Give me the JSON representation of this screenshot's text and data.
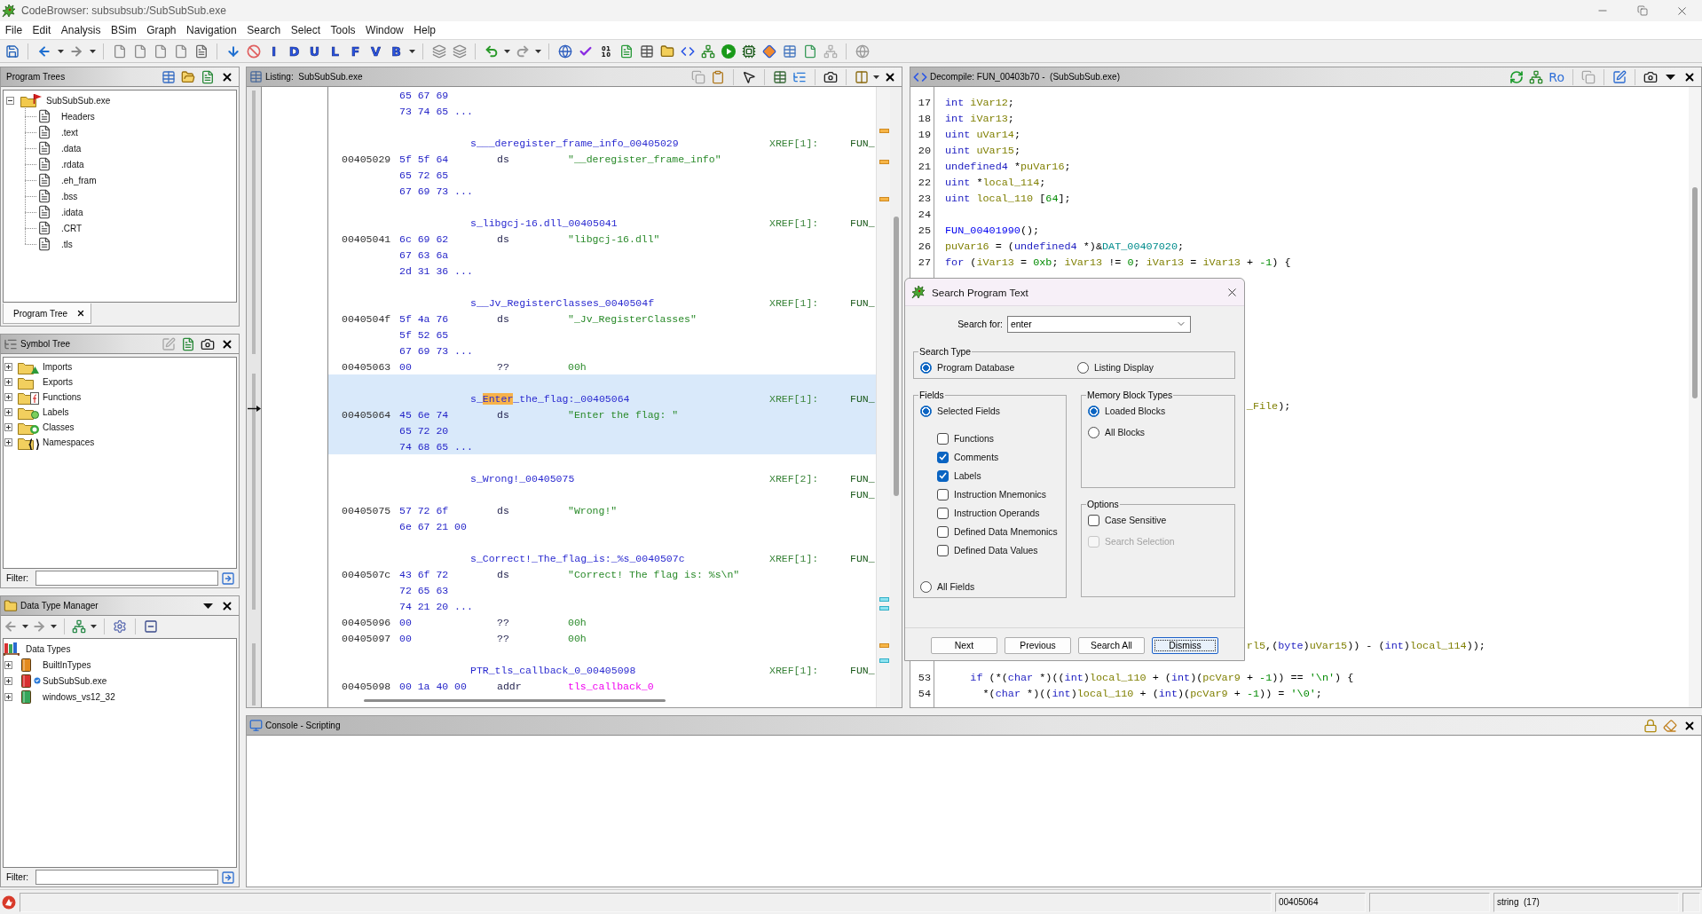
{
  "window": {
    "title": "CodeBrowser: subsubsub:/SubSubSub.exe"
  },
  "menu": [
    "File",
    "Edit",
    "Analysis",
    "BSim",
    "Graph",
    "Navigation",
    "Search",
    "Select",
    "Tools",
    "Window",
    "Help"
  ],
  "toolbar": {
    "letter_buttons": [
      "I",
      "D",
      "U",
      "L",
      "F",
      "V",
      "B"
    ]
  },
  "program_trees": {
    "title": "Program Trees",
    "root": {
      "label": "SubSubSub.exe",
      "expanded": true,
      "children": [
        {
          "label": "Headers"
        },
        {
          "label": ".text"
        },
        {
          "label": ".data"
        },
        {
          "label": ".rdata"
        },
        {
          "label": ".eh_fram"
        },
        {
          "label": ".bss"
        },
        {
          "label": ".idata"
        },
        {
          "label": ".CRT"
        },
        {
          "label": ".tls"
        }
      ]
    },
    "tab": {
      "label": "Program Tree",
      "selected": true
    }
  },
  "symbol_tree": {
    "title": "Symbol Tree",
    "items": [
      {
        "label": "Imports",
        "kind": "imports",
        "expanded": false
      },
      {
        "label": "Exports",
        "kind": "exports",
        "expanded": false
      },
      {
        "label": "Functions",
        "kind": "functions",
        "expanded": false
      },
      {
        "label": "Labels",
        "kind": "labels",
        "expanded": false
      },
      {
        "label": "Classes",
        "kind": "classes",
        "expanded": false
      },
      {
        "label": "Namespaces",
        "kind": "namespaces",
        "expanded": false
      }
    ],
    "filter_label": "Filter:"
  },
  "data_type_manager": {
    "title": "Data Type Manager",
    "root": {
      "label": "Data Types",
      "children": [
        {
          "label": "BuiltInTypes",
          "kind": "builtin",
          "expanded": false
        },
        {
          "label": "SubSubSub.exe",
          "kind": "program",
          "expanded": false
        },
        {
          "label": "windows_vs12_32",
          "kind": "archive",
          "expanded": false
        }
      ]
    },
    "filter_label": "Filter:"
  },
  "listing": {
    "title": "Listing:  SubSubSub.exe",
    "rows": [
      {
        "kind": "data",
        "selected": false,
        "bytes": "65 67 69"
      },
      {
        "kind": "data",
        "selected": false,
        "bytes": "73 74 65 ..."
      },
      {
        "kind": "blank",
        "selected": false
      },
      {
        "kind": "label",
        "selected": false,
        "label": [
          {
            "text": "s___deregister_frame_info_00405029",
            "match": false
          }
        ],
        "xref": "XREF[1]:",
        "xref_from": "FUN_"
      },
      {
        "kind": "data",
        "selected": false,
        "address": "00405029",
        "bytes": "5f 5f 64",
        "mnemonic": "ds",
        "operand": {
          "text": "\"__deregister_frame_info\"",
          "kind": "string"
        }
      },
      {
        "kind": "data",
        "selected": false,
        "bytes": "65 72 65"
      },
      {
        "kind": "data",
        "selected": false,
        "bytes": "67 69 73 ..."
      },
      {
        "kind": "blank",
        "selected": false
      },
      {
        "kind": "label",
        "selected": false,
        "label": [
          {
            "text": "s_libgcj-16.dll_00405041",
            "match": false
          }
        ],
        "xref": "XREF[1]:",
        "xref_from": "FUN_"
      },
      {
        "kind": "data",
        "selected": false,
        "address": "00405041",
        "bytes": "6c 69 62",
        "mnemonic": "ds",
        "operand": {
          "text": "\"libgcj-16.dll\"",
          "kind": "string"
        }
      },
      {
        "kind": "data",
        "selected": false,
        "bytes": "67 63 6a"
      },
      {
        "kind": "data",
        "selected": false,
        "bytes": "2d 31 36 ..."
      },
      {
        "kind": "blank",
        "selected": false
      },
      {
        "kind": "label",
        "selected": false,
        "label": [
          {
            "text": "s__Jv_RegisterClasses_0040504f",
            "match": false
          }
        ],
        "xref": "XREF[1]:",
        "xref_from": "FUN_"
      },
      {
        "kind": "data",
        "selected": false,
        "address": "0040504f",
        "bytes": "5f 4a 76",
        "mnemonic": "ds",
        "operand": {
          "text": "\"_Jv_RegisterClasses\"",
          "kind": "string"
        }
      },
      {
        "kind": "data",
        "selected": false,
        "bytes": "5f 52 65"
      },
      {
        "kind": "data",
        "selected": false,
        "bytes": "67 69 73 ..."
      },
      {
        "kind": "data",
        "selected": false,
        "address": "00405063",
        "bytes": "00",
        "mnemonic": "??",
        "operand": {
          "text": "00h",
          "kind": "scalar"
        }
      },
      {
        "kind": "blank",
        "selected": true
      },
      {
        "kind": "label",
        "selected": true,
        "label": [
          {
            "text": "s_",
            "match": false
          },
          {
            "text": "Enter",
            "match": true
          },
          {
            "text": "_the_flag:_00405064",
            "match": false
          }
        ],
        "xref": "XREF[1]:",
        "xref_from": "FUN_"
      },
      {
        "kind": "data",
        "selected": true,
        "address": "00405064",
        "bytes": "45 6e 74",
        "mnemonic": "ds",
        "operand": {
          "text": "\"Enter the flag: \"",
          "kind": "string"
        }
      },
      {
        "kind": "data",
        "selected": true,
        "bytes": "65 72 20"
      },
      {
        "kind": "data",
        "selected": true,
        "bytes": "74 68 65 ..."
      },
      {
        "kind": "blank",
        "selected": false
      },
      {
        "kind": "label",
        "selected": false,
        "label": [
          {
            "text": "s_Wrong!_00405075",
            "match": false
          }
        ],
        "xref": "XREF[2]:",
        "xref_from": "FUN_"
      },
      {
        "kind": "xref",
        "selected": false,
        "xref_from": "FUN_"
      },
      {
        "kind": "data",
        "selected": false,
        "address": "00405075",
        "bytes": "57 72 6f",
        "mnemonic": "ds",
        "operand": {
          "text": "\"Wrong!\"",
          "kind": "string"
        }
      },
      {
        "kind": "data",
        "selected": false,
        "bytes": "6e 67 21 00"
      },
      {
        "kind": "blank",
        "selected": false
      },
      {
        "kind": "label",
        "selected": false,
        "label": [
          {
            "text": "s_Correct!_The_flag_is:_%s_0040507c",
            "match": false
          }
        ],
        "xref": "XREF[1]:",
        "xref_from": "FUN_"
      },
      {
        "kind": "data",
        "selected": false,
        "address": "0040507c",
        "bytes": "43 6f 72",
        "mnemonic": "ds",
        "operand": {
          "text": "\"Correct! The flag is: %s\\n\"",
          "kind": "string"
        }
      },
      {
        "kind": "data",
        "selected": false,
        "bytes": "72 65 63"
      },
      {
        "kind": "data",
        "selected": false,
        "bytes": "74 21 20 ..."
      },
      {
        "kind": "data",
        "selected": false,
        "address": "00405096",
        "bytes": "00",
        "mnemonic": "??",
        "operand": {
          "text": "00h",
          "kind": "scalar"
        }
      },
      {
        "kind": "data",
        "selected": false,
        "address": "00405097",
        "bytes": "00",
        "mnemonic": "??",
        "operand": {
          "text": "00h",
          "kind": "scalar"
        }
      },
      {
        "kind": "blank",
        "selected": false
      },
      {
        "kind": "label",
        "selected": false,
        "label": [
          {
            "text": "PTR_tls_callback_0_00405098",
            "match": false
          }
        ],
        "xref": "XREF[1]:",
        "xref_from": "FUN_"
      },
      {
        "kind": "data",
        "selected": false,
        "address": "00405098",
        "bytes": "00 1a 40 00",
        "mnemonic": "addr",
        "operand": {
          "text": "tls_callback_0",
          "kind": "pointer"
        }
      }
    ]
  },
  "decompiler": {
    "title": "Decompile: FUN_00403b70 -  (SubSubSub.exe)",
    "toggle_label": "Ro",
    "top_lines": [
      {
        "number": "17",
        "tokens": [
          {
            "text": "int",
            "kind": "type"
          },
          {
            "text": " iVar12",
            "kind": "var"
          },
          {
            "text": ";",
            "kind": "plain"
          }
        ]
      },
      {
        "number": "18",
        "tokens": [
          {
            "text": "int",
            "kind": "type"
          },
          {
            "text": " iVar13",
            "kind": "var"
          },
          {
            "text": ";",
            "kind": "plain"
          }
        ]
      },
      {
        "number": "19",
        "tokens": [
          {
            "text": "uint",
            "kind": "type"
          },
          {
            "text": " uVar14",
            "kind": "var"
          },
          {
            "text": ";",
            "kind": "plain"
          }
        ]
      },
      {
        "number": "20",
        "tokens": [
          {
            "text": "uint",
            "kind": "type"
          },
          {
            "text": " uVar15",
            "kind": "var"
          },
          {
            "text": ";",
            "kind": "plain"
          }
        ]
      },
      {
        "number": "21",
        "tokens": [
          {
            "text": "undefined4",
            "kind": "type"
          },
          {
            "text": " *",
            "kind": "plain"
          },
          {
            "text": "puVar16",
            "kind": "var"
          },
          {
            "text": ";",
            "kind": "plain"
          }
        ]
      },
      {
        "number": "22",
        "tokens": [
          {
            "text": "uint",
            "kind": "type"
          },
          {
            "text": " *",
            "kind": "plain"
          },
          {
            "text": "local_114",
            "kind": "var"
          },
          {
            "text": ";",
            "kind": "plain"
          }
        ]
      },
      {
        "number": "23",
        "tokens": [
          {
            "text": "uint",
            "kind": "type"
          },
          {
            "text": " local_110",
            "kind": "var"
          },
          {
            "text": " [",
            "kind": "plain"
          },
          {
            "text": "64",
            "kind": "const"
          },
          {
            "text": "];",
            "kind": "plain"
          }
        ]
      },
      {
        "number": "24"
      },
      {
        "number": "25",
        "tokens": [
          {
            "text": "FUN_00401990",
            "kind": "func"
          },
          {
            "text": "();",
            "kind": "plain"
          }
        ]
      },
      {
        "number": "26",
        "tokens": [
          {
            "text": "puVar16",
            "kind": "var"
          },
          {
            "text": " = (",
            "kind": "plain"
          },
          {
            "text": "undefined4",
            "kind": "type"
          },
          {
            "text": " *)&",
            "kind": "plain"
          },
          {
            "text": "DAT_00407020",
            "kind": "global"
          },
          {
            "text": ";",
            "kind": "plain"
          }
        ]
      },
      {
        "number": "27",
        "tokens": [
          {
            "text": "for",
            "kind": "keyword"
          },
          {
            "text": " (",
            "kind": "plain"
          },
          {
            "text": "iVar13",
            "kind": "var"
          },
          {
            "text": " = ",
            "kind": "plain"
          },
          {
            "text": "0xb",
            "kind": "const"
          },
          {
            "text": "; ",
            "kind": "plain"
          },
          {
            "text": "iVar13",
            "kind": "var"
          },
          {
            "text": " != ",
            "kind": "plain"
          },
          {
            "text": "0",
            "kind": "const"
          },
          {
            "text": "; ",
            "kind": "plain"
          },
          {
            "text": "iVar13",
            "kind": "var"
          },
          {
            "text": " = ",
            "kind": "plain"
          },
          {
            "text": "iVar13",
            "kind": "var"
          },
          {
            "text": " + ",
            "kind": "plain"
          },
          {
            "text": "-1",
            "kind": "const"
          },
          {
            "text": ") {",
            "kind": "plain"
          }
        ]
      }
    ],
    "tail_lines": [
      {
        "tokens": [
          {
            "text": "_File",
            "kind": "var"
          },
          {
            "text": ");",
            "kind": "plain"
          }
        ]
      },
      {
        "tokens": [
          {
            "text": "rl5",
            "kind": "var"
          },
          {
            "text": ",(",
            "kind": "plain"
          },
          {
            "text": "byte",
            "kind": "type"
          },
          {
            "text": ")",
            "kind": "plain"
          },
          {
            "text": "uVar15",
            "kind": "var"
          },
          {
            "text": ")) - (",
            "kind": "plain"
          },
          {
            "text": "int",
            "kind": "type"
          },
          {
            "text": ")",
            "kind": "plain"
          },
          {
            "text": "local_114",
            "kind": "var"
          },
          {
            "text": "));",
            "kind": "plain"
          }
        ]
      }
    ],
    "bottom_lines": [
      {
        "number": "53",
        "tokens": [
          {
            "text": "    if",
            "kind": "keyword"
          },
          {
            "text": " (*(",
            "kind": "plain"
          },
          {
            "text": "char",
            "kind": "type"
          },
          {
            "text": " *)((",
            "kind": "plain"
          },
          {
            "text": "int",
            "kind": "type"
          },
          {
            "text": ")",
            "kind": "plain"
          },
          {
            "text": "local_110",
            "kind": "var"
          },
          {
            "text": " + (",
            "kind": "plain"
          },
          {
            "text": "int",
            "kind": "type"
          },
          {
            "text": ")(",
            "kind": "plain"
          },
          {
            "text": "pcVar9",
            "kind": "var"
          },
          {
            "text": " + ",
            "kind": "plain"
          },
          {
            "text": "-1",
            "kind": "const"
          },
          {
            "text": ")) == ",
            "kind": "plain"
          },
          {
            "text": "'\\n'",
            "kind": "const"
          },
          {
            "text": ") {",
            "kind": "plain"
          }
        ]
      },
      {
        "number": "54",
        "tokens": [
          {
            "text": "      *(",
            "kind": "plain"
          },
          {
            "text": "char",
            "kind": "type"
          },
          {
            "text": " *)((",
            "kind": "plain"
          },
          {
            "text": "int",
            "kind": "type"
          },
          {
            "text": ")",
            "kind": "plain"
          },
          {
            "text": "local_110",
            "kind": "var"
          },
          {
            "text": " + (",
            "kind": "plain"
          },
          {
            "text": "int",
            "kind": "type"
          },
          {
            "text": ")(",
            "kind": "plain"
          },
          {
            "text": "pcVar9",
            "kind": "var"
          },
          {
            "text": " + ",
            "kind": "plain"
          },
          {
            "text": "-1",
            "kind": "const"
          },
          {
            "text": ")) = ",
            "kind": "plain"
          },
          {
            "text": "'\\0'",
            "kind": "const"
          },
          {
            "text": ";",
            "kind": "plain"
          }
        ]
      }
    ]
  },
  "search_dialog": {
    "title": "Search Program Text",
    "search_label": "Search for:",
    "search_value": "enter",
    "search_type": {
      "title": "Search Type",
      "options": [
        {
          "label": "Program Database",
          "selected": true
        },
        {
          "label": "Listing Display",
          "selected": false
        }
      ]
    },
    "fields": {
      "title": "Fields",
      "selected_option": {
        "label": "Selected Fields",
        "selected": true
      },
      "checkboxes": [
        {
          "label": "Functions",
          "checked": false
        },
        {
          "label": "Comments",
          "checked": true
        },
        {
          "label": "Labels",
          "checked": true
        },
        {
          "label": "Instruction Mnemonics",
          "checked": false
        },
        {
          "label": "Instruction Operands",
          "checked": false
        },
        {
          "label": "Defined Data Mnemonics",
          "checked": false
        },
        {
          "label": "Defined Data Values",
          "checked": false
        }
      ],
      "all_option": {
        "label": "All Fields",
        "selected": false
      }
    },
    "memory_blocks": {
      "title": "Memory Block Types",
      "options": [
        {
          "label": "Loaded Blocks",
          "selected": true
        },
        {
          "label": "All Blocks",
          "selected": false
        }
      ]
    },
    "options": {
      "title": "Options",
      "checkboxes": [
        {
          "label": "Case Sensitive",
          "checked": false,
          "disabled": false
        },
        {
          "label": "Search Selection",
          "checked": false,
          "disabled": true
        }
      ]
    },
    "buttons": [
      {
        "label": "Next",
        "focused": false
      },
      {
        "label": "Previous",
        "focused": false
      },
      {
        "label": "Search All",
        "focused": false
      },
      {
        "label": "Dismiss",
        "focused": true
      }
    ]
  },
  "console": {
    "title": "Console - Scripting"
  },
  "status_bar": {
    "address": "00405064",
    "data_type": "string  (17)"
  }
}
